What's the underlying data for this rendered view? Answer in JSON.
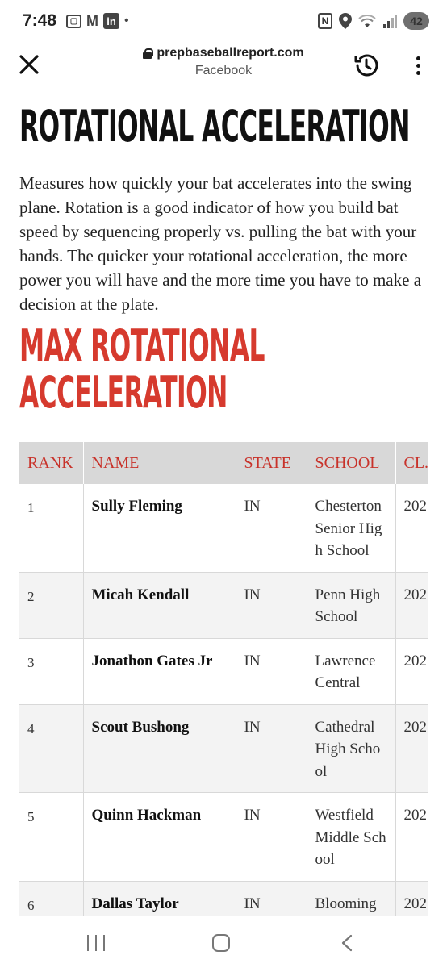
{
  "status_bar": {
    "time": "7:48",
    "notification_icons": [
      "screenshot-icon",
      "gmail-icon",
      "linkedin-icon",
      "dot-icon"
    ],
    "linkedin_label": "in",
    "gmail_label": "M",
    "nfc_label": "N",
    "battery": "42",
    "right_icons": [
      "nfc-icon",
      "location-icon",
      "wifi-icon",
      "signal-icon",
      "battery-icon"
    ]
  },
  "browser": {
    "domain": "prepbaseballreport.com",
    "subtitle": "Facebook",
    "icons": [
      "close-icon",
      "lock-icon",
      "history-icon",
      "more-vert-icon"
    ]
  },
  "article": {
    "heading": "ROTATIONAL ACCELERATION",
    "description": "Measures how quickly your bat accelerates into the swing plane. Rotation is a good indicator of how you build bat speed by sequencing properly vs. pulling the bat with your hands. The quicker your rotational acceleration, the more power you will have and the more time you have to make a decision at the plate.",
    "subheading_line1": "MAX ROTATIONAL",
    "subheading_line2": "ACCELERATION",
    "accent_color": "#d63a2e"
  },
  "table": {
    "headers": [
      "RANK",
      "NAME",
      "STATE",
      "SCHOOL",
      "CL..."
    ],
    "rows": [
      {
        "rank": "1",
        "name": "Sully Fleming",
        "state": "IN",
        "school": "Chesterton Senior High School",
        "class": "202"
      },
      {
        "rank": "2",
        "name": "Micah Kendall",
        "state": "IN",
        "school": "Penn High School",
        "class": "202"
      },
      {
        "rank": "3",
        "name": "Jonathon Gates Jr",
        "state": "IN",
        "school": "Lawrence Central",
        "class": "202"
      },
      {
        "rank": "4",
        "name": "Scout Bushong",
        "state": "IN",
        "school": "Cathedral High School",
        "class": "202"
      },
      {
        "rank": "5",
        "name": "Quinn Hackman",
        "state": "IN",
        "school": "Westfield Middle School",
        "class": "202"
      },
      {
        "rank": "6",
        "name": "Dallas Taylor",
        "state": "IN",
        "school": "Blooming",
        "class": "202"
      }
    ]
  },
  "nav": {
    "icons": [
      "recents-icon",
      "home-icon",
      "back-icon"
    ]
  }
}
